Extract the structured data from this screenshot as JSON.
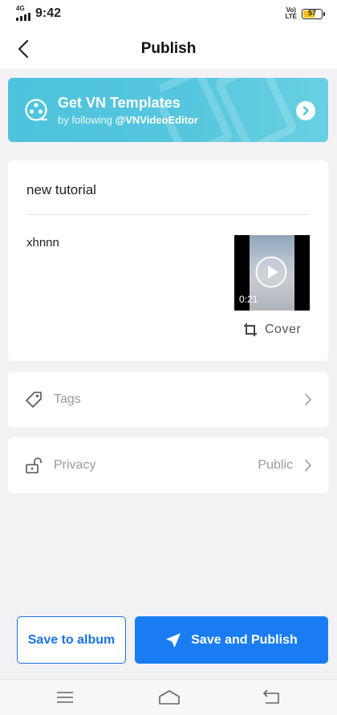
{
  "status_bar": {
    "network": "4G",
    "time": "9:42",
    "volte": [
      "Vo)",
      "LTE"
    ],
    "battery": "57"
  },
  "header": {
    "back_icon": "chevron-left-icon",
    "title": "Publish"
  },
  "banner": {
    "title": "Get VN Templates",
    "subtitle_prefix": "by following ",
    "subtitle_handle": "@VNVideoEditor",
    "logo_icon": "film-reel-icon",
    "arrow_icon": "chevron-right-icon"
  },
  "post": {
    "title": "new tutorial",
    "description": "xhnnn",
    "video_duration": "0:21",
    "cover_label": "Cover",
    "cover_icon": "crop-icon",
    "play_icon": "play-icon"
  },
  "settings": {
    "tags": {
      "label": "Tags",
      "icon": "tag-icon"
    },
    "privacy": {
      "label": "Privacy",
      "value": "Public",
      "icon": "unlock-icon"
    }
  },
  "actions": {
    "save_to_album": "Save to album",
    "save_and_publish": "Save and Publish",
    "publish_icon": "send-icon"
  },
  "nav": {
    "menu_icon": "menu-icon",
    "home_icon": "home-icon",
    "back_icon": "back-icon"
  },
  "colors": {
    "accent": "#1a7cf2",
    "banner": "#4ec3dd",
    "background": "#f2f2f4"
  }
}
